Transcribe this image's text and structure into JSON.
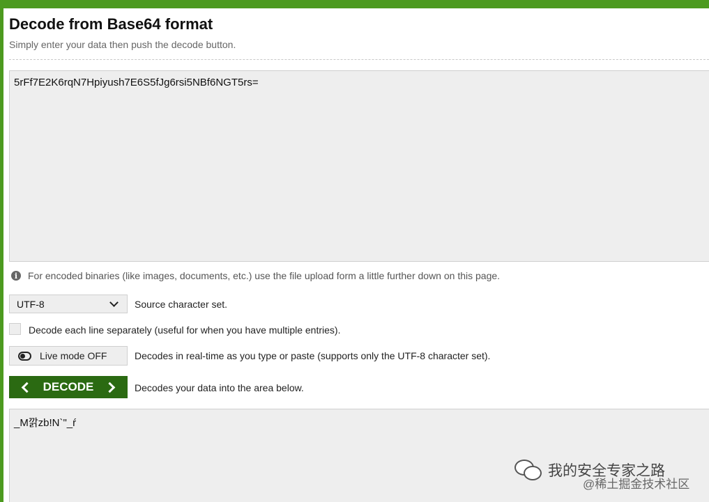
{
  "header": {
    "title": "Decode from Base64 format",
    "subtitle": "Simply enter your data then push the decode button."
  },
  "input": {
    "value": "5rFf7E2K6rqN7Hpiyush7E6S5fJg6rsi5NBf6NGT5rs="
  },
  "info": {
    "icon": "info-icon",
    "text": "For encoded binaries (like images, documents, etc.) use the file upload form a little further down on this page."
  },
  "charset": {
    "selected": "UTF-8",
    "label": "Source character set."
  },
  "line_option": {
    "checked": false,
    "label": "Decode each line separately (useful for when you have multiple entries)."
  },
  "live_mode": {
    "icon": "toggle-icon",
    "button_label": "Live mode OFF",
    "description": "Decodes in real-time as you type or paste (supports only the UTF-8 character set)."
  },
  "decode": {
    "button_label": "DECODE",
    "description": "Decodes your data into the area below."
  },
  "output": {
    "value": "_M깕zb!N`\"_ŕ"
  },
  "watermark": {
    "icon": "wechat-icon",
    "text": "我的安全专家之路",
    "sub": "@稀土掘金技术社区"
  },
  "colors": {
    "accent": "#4c9a1f",
    "button": "#2b6a12",
    "field_bg": "#eeeeee"
  }
}
